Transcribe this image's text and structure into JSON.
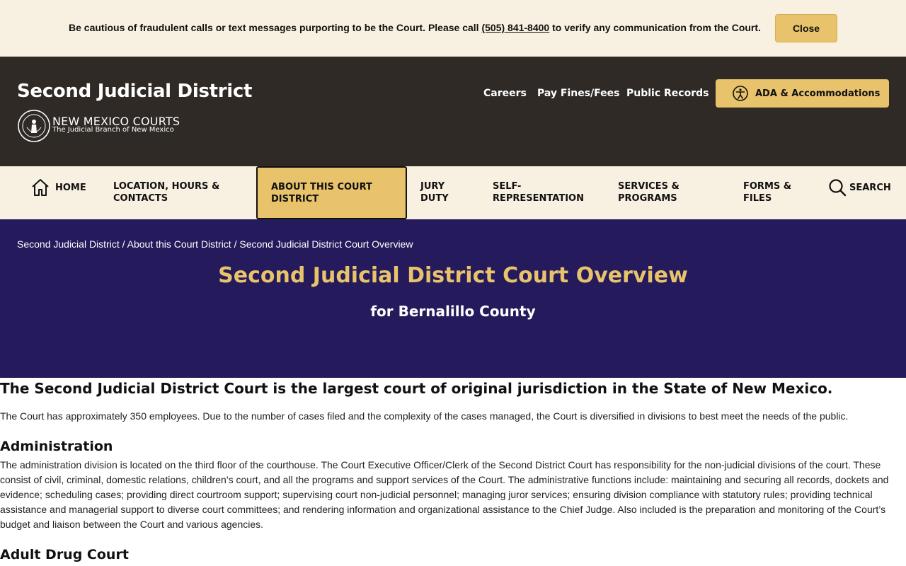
{
  "alert": {
    "text_before": "Be cautious of fraudulent calls or text messages purporting to be the Court. Please call ",
    "phone": "(505) 841-8400",
    "text_after": " to verify any communication from the Court.",
    "close_label": "Close"
  },
  "header": {
    "site_title": "Second Judicial District",
    "logo_main": "NEW MEXICO COURTS",
    "logo_sub": "The Judicial Branch of New Mexico",
    "links": [
      "Careers",
      "Pay Fines/Fees",
      "Public Records"
    ],
    "ada_label": "ADA & Accommodations"
  },
  "nav": {
    "home": "HOME",
    "location": "LOCATION, HOURS & CONTACTS",
    "about": "ABOUT THIS COURT DISTRICT",
    "jury": "JURY DUTY",
    "self": "SELF-REPRESENTATION",
    "services": "SERVICES & PROGRAMS",
    "forms": "FORMS & FILES",
    "search": "SEARCH"
  },
  "hero": {
    "breadcrumb": [
      "Second Judicial District",
      "About this Court District",
      "Second Judicial District Court Overview"
    ],
    "breadcrumb_sep": " / ",
    "title": "Second Judicial District Court Overview",
    "subtitle": "for Bernalillo County"
  },
  "content": {
    "lead_heading": "The Second Judicial District Court is the largest court of original jurisdiction in the State of New Mexico.",
    "intro": "The Court has approximately 350 employees. Due to the number of cases filed and the complexity of the cases managed, the Court is diversified in divisions to best meet the needs of the public.",
    "admin_heading": "Administration",
    "admin_text": "The administration division is located on the third floor of the courthouse.  The Court Executive Officer/Clerk of the Second District Court has responsibility for the non-judicial divisions of the court. These consist of civil, criminal, domestic relations, children’s court, and all the programs and support services of the Court. The administrative functions include: maintaining and securing all records, dockets and evidence; scheduling cases; providing direct courtroom support; supervising court non-judicial personnel; managing juror services; ensuring division compliance with statutory rules; providing technical assistance and managerial support to diverse court committees; and rendering information and organizational assistance to the Chief Judge. Also included is the preparation and monitoring of the Court’s budget and liaison between the Court and various agencies.",
    "drug_heading": "Adult Drug Court"
  },
  "colors": {
    "banner_bg": "#f8f1e1",
    "header_bg": "#2f2a26",
    "accent_gold": "#e8c36b",
    "hero_bg": "#251a5b"
  },
  "icons": {
    "home": "home-icon",
    "search": "search-icon",
    "accessibility": "accessibility-icon",
    "seal": "court-seal-icon"
  }
}
